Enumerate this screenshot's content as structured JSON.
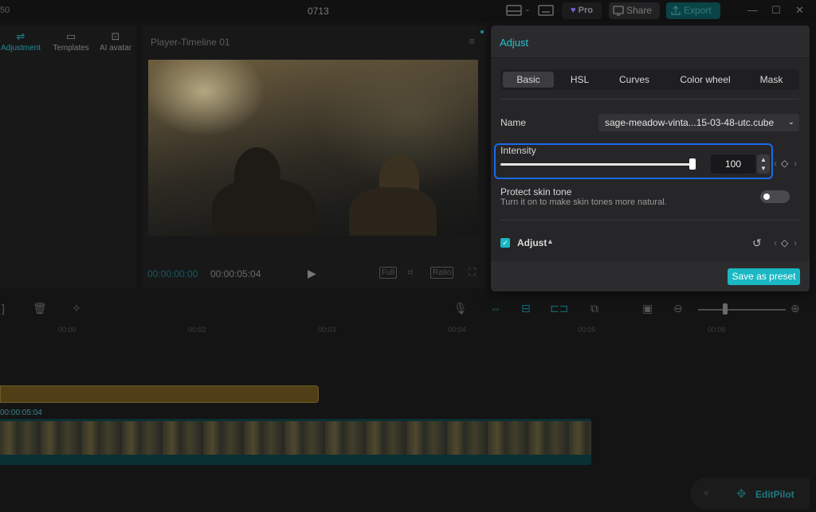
{
  "titlebar": {
    "left_fragment": "50",
    "title": "0713",
    "pro_label": "Pro",
    "share_label": "Share",
    "export_label": "Export",
    "colors": {
      "accent": "#1ab8c4",
      "pro_heart": "#7b5fd6"
    }
  },
  "left_panel": {
    "tabs": [
      {
        "label": "Adjustment",
        "icon": "adjustment-icon",
        "active": true
      },
      {
        "label": "Templates",
        "icon": "templates-icon",
        "active": false
      },
      {
        "label": "AI avatar",
        "icon": "ai-avatar-icon",
        "active": false
      }
    ]
  },
  "player": {
    "title": "Player-Timeline 01",
    "current_time": "00:00:00:00",
    "total_time": "00:00:05:04",
    "controls": {
      "full_label": "Full",
      "ratio_label": "Ratio"
    }
  },
  "adjust_panel": {
    "title": "Adjust",
    "tabs": [
      {
        "label": "Basic",
        "active": true
      },
      {
        "label": "HSL",
        "active": false
      },
      {
        "label": "Curves",
        "active": false
      },
      {
        "label": "Color wheel",
        "active": false
      },
      {
        "label": "Mask",
        "active": false
      }
    ],
    "name_label": "Name",
    "name_value": "sage-meadow-vinta...15-03-48-utc.cube",
    "intensity_label": "Intensity",
    "intensity_value": "100",
    "intensity_level": 1.0,
    "protect_label": "Protect skin tone",
    "protect_desc": "Turn it on to make skin tones more natural.",
    "protect_on": false,
    "adjust_section_label": "Adjust",
    "adjust_checked": true,
    "save_preset_label": "Save as preset"
  },
  "timeline": {
    "ruler": [
      "00:00",
      "00:02",
      "00:03",
      "00:04",
      "00:05",
      "00:06"
    ],
    "clip_time": "00:00:05:04"
  },
  "editpilot": {
    "label": "EditPilot"
  }
}
